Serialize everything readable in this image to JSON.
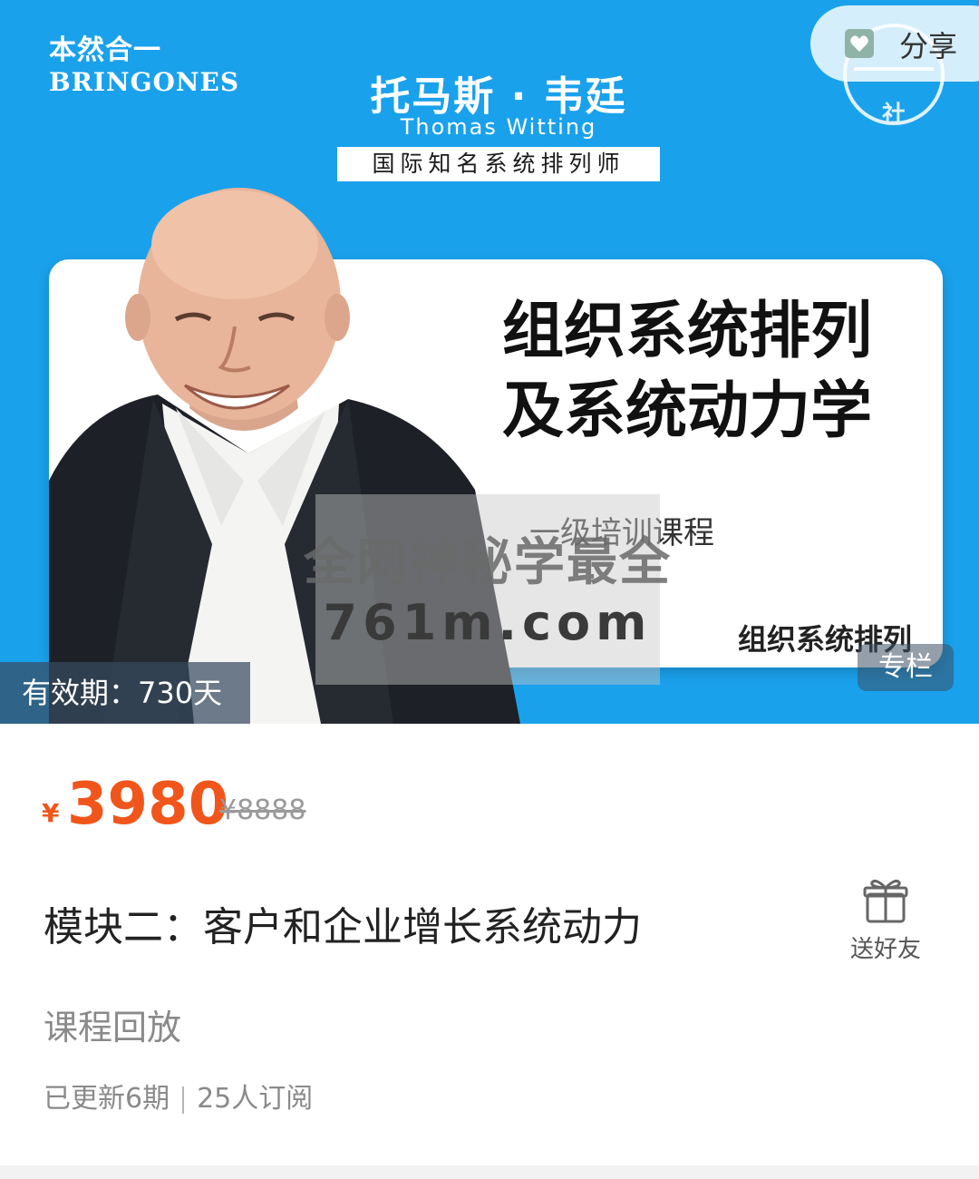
{
  "banner": {
    "brand_cn": "本然合一",
    "brand_en": "BRINGONES",
    "speaker_name": "托马斯 · 韦廷",
    "speaker_en": "Thomas Witting",
    "speaker_title": "国际知名系统排列师",
    "stamp_text": "社",
    "card_title_line1": "组织系统排列",
    "card_title_line2": "及系统动力学",
    "card_subtitle": "一级培训课程",
    "card_footer": "组织系统排列",
    "watermark_line1": "全网神秘学最全",
    "watermark_line2": "761m.com",
    "validity": "有效期：730天",
    "column_tag": "专栏",
    "share_label": "分享"
  },
  "product": {
    "currency": "¥",
    "price": "3980",
    "original_price": "¥8888",
    "title": "模块二：客户和企业增长系统动力",
    "gift_label": "送好友",
    "subtitle": "课程回放",
    "updates": "已更新6期",
    "subscribers": "25人订阅"
  },
  "colors": {
    "banner_blue": "#1aa1ec",
    "price_orange": "#f0561c"
  },
  "icons": [
    "share-icon",
    "gift-icon"
  ]
}
